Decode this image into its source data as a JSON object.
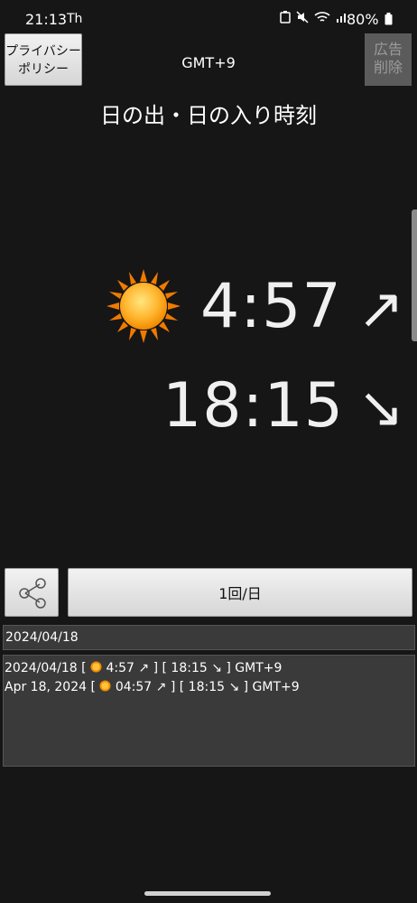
{
  "status_bar": {
    "time": "21:13",
    "carrier_icon": "Th",
    "battery": "80%"
  },
  "header": {
    "privacy_label": "プライバシー\nポリシー",
    "timezone": "GMT+9",
    "remove_ads_label": "広告\n削除"
  },
  "title": "日の出・日の入り時刻",
  "sunrise": {
    "time": "4:57",
    "arrow": "↗"
  },
  "sunset": {
    "time": "18:15",
    "arrow": "↘"
  },
  "controls": {
    "frequency_label": "1回/日"
  },
  "date_value": "2024/04/18",
  "log": [
    {
      "prefix": "2024/04/18 [ ",
      "rise": "4:57 ↗ ]",
      "rest": " [ 18:15 ↘ ] GMT+9"
    },
    {
      "prefix": "Apr 18, 2024 [ ",
      "rise": "04:57 ↗ ]",
      "rest": " [ 18:15 ↘ ] GMT+9"
    }
  ],
  "colors": {
    "background": "#161616",
    "sun": "#f5a623"
  }
}
